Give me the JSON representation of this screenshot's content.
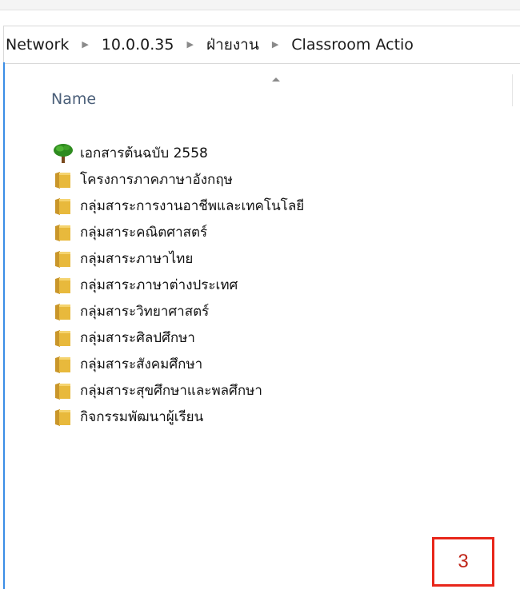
{
  "breadcrumb": {
    "items": [
      "Network",
      "10.0.0.35",
      "ฝ่ายงาน",
      "Classroom Actio"
    ],
    "separator": "▶"
  },
  "column_header": {
    "name_label": "Name"
  },
  "files": [
    {
      "label": "เอกสารต้นฉบับ 2558",
      "icon": "tree-icon"
    },
    {
      "label": "โครงการภาคภาษาอังกฤษ",
      "icon": "folder-icon"
    },
    {
      "label": "กลุ่มสาระการงานอาชีพและเทคโนโลยี",
      "icon": "folder-icon"
    },
    {
      "label": "กลุ่มสาระคณิตศาสตร์",
      "icon": "folder-icon"
    },
    {
      "label": "กลุ่มสาระภาษาไทย",
      "icon": "folder-icon"
    },
    {
      "label": "กลุ่มสาระภาษาต่างประเทศ",
      "icon": "folder-icon"
    },
    {
      "label": "กลุ่มสาระวิทยาศาสตร์",
      "icon": "folder-icon"
    },
    {
      "label": "กลุ่มสาระศิลปศึกษา",
      "icon": "folder-icon"
    },
    {
      "label": "กลุ่มสาระสังคมศึกษา",
      "icon": "folder-icon"
    },
    {
      "label": "กลุ่มสาระสุขศึกษาและพลศึกษา",
      "icon": "folder-icon"
    },
    {
      "label": "กิจกรรมพัฒนาผู้เรียน",
      "icon": "folder-icon"
    }
  ],
  "page_badge": {
    "number": "3"
  },
  "colors": {
    "folder": "#E8B93C",
    "folder_dark": "#C9962A",
    "tree_leaves": "#2E8B1F",
    "tree_trunk": "#7A4A1E",
    "badge_border": "#E8261A",
    "accent_edge": "#3A8EE6"
  }
}
